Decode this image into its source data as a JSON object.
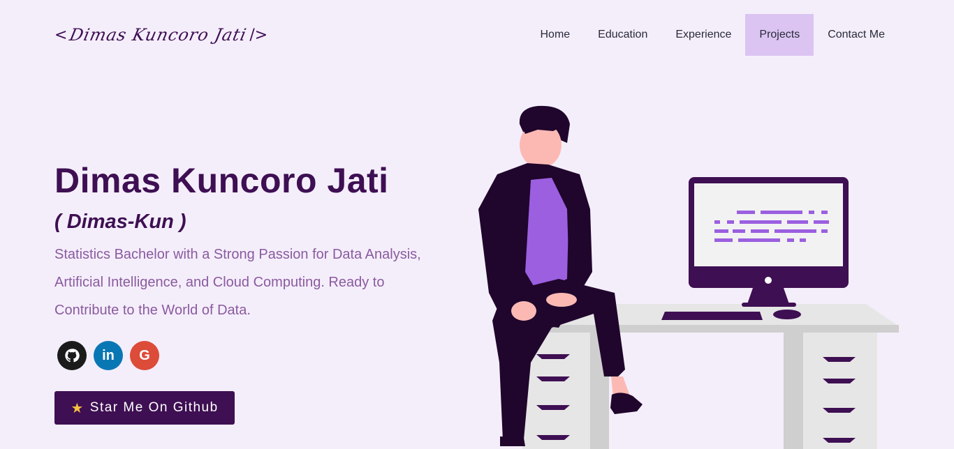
{
  "logo": {
    "open": "<",
    "signature": "Dimas Kuncoro Jati",
    "close": "/>"
  },
  "nav": {
    "items": [
      {
        "label": "Home"
      },
      {
        "label": "Education"
      },
      {
        "label": "Experience"
      },
      {
        "label": "Projects",
        "active": true
      },
      {
        "label": "Contact Me"
      }
    ]
  },
  "hero": {
    "name": "Dimas Kuncoro Jati",
    "nickname": "( Dimas-Kun )",
    "tagline": "Statistics Bachelor with a Strong Passion for Data Analysis, Artificial Intelligence, and Cloud Computing. Ready to Contribute to the World of Data."
  },
  "socials": [
    {
      "icon": "github-icon",
      "glyph": ""
    },
    {
      "icon": "linkedin-icon",
      "glyph": "in"
    },
    {
      "icon": "google-icon",
      "glyph": "G"
    }
  ],
  "cta": {
    "icon": "star-icon",
    "label": "Star Me On Github"
  },
  "colors": {
    "primary": "#3e0f52",
    "accent": "#9b5fe0",
    "active_nav": "#dbc4f2",
    "background": "#f4eefb"
  }
}
